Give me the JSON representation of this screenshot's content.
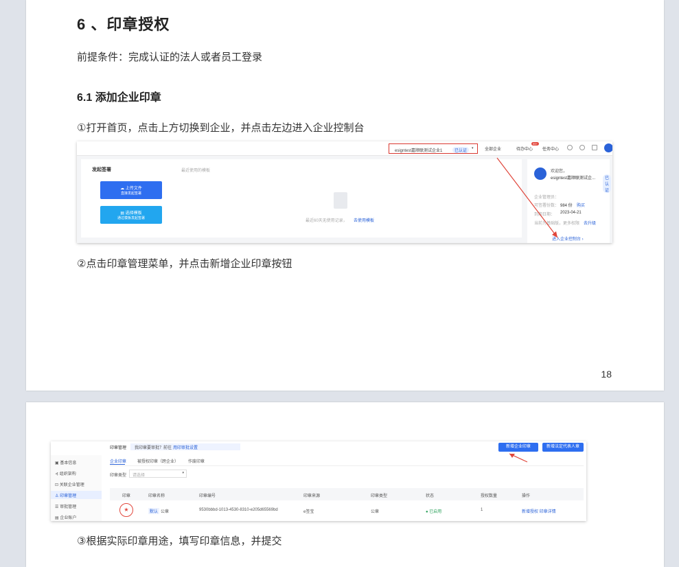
{
  "page1": {
    "heading": "6 、印章授权",
    "prerequisite": "前提条件：完成认证的法人或者员工登录",
    "subheading": "6.1 添加企业印章",
    "step1": "①打开首页，点击上方切换到企业，并点击左边进入企业控制台",
    "step2": "②点击印章管理菜单，并点击新增企业印章按钮",
    "page_number": "18",
    "screenshot": {
      "org_name": "esigntest嘉顺联测试企业1",
      "org_badge": "已认证",
      "menu": [
        "全部企业",
        "待办中心",
        "任务中心"
      ],
      "todo_count": "99+",
      "section_title": "发起签署",
      "recent_label": "最近使用的模板",
      "upload_btn": "上传文件",
      "upload_sub": "直接发起签署",
      "template_btn": "选择模板",
      "template_sub": "通过模板发起签署",
      "empty_text": "最近60天无使用记录，",
      "empty_link": "去使用模板",
      "welcome": "欢迎您，",
      "company": "esigntest嘉顺联测试企...",
      "company_badge": "已认证",
      "admin_label": "企业管理员：",
      "quota_label": "可签署份数：",
      "quota_value": "984 份",
      "buy_link": "购买",
      "expiry_label": "到期日期：",
      "expiry_value": "2023-04-21",
      "upgrade_text": "当前为基础版，更多权限",
      "upgrade_link": "去升级",
      "console_link": "进入企业控制台 ›"
    }
  },
  "page2": {
    "step3": "③根据实际印章用途，填写印章信息，并提交",
    "screenshot": {
      "title": "印章管理",
      "notice": "我印章要审批？前往",
      "notice_link": "用印审批设置",
      "btn_add": "新增企业印章",
      "btn_legal": "新增法定代表人章",
      "tabs": [
        "企业印章",
        "被授权印章（跨企业）",
        "作废印章"
      ],
      "filter_label": "印章类型",
      "filter_placeholder": "请选择",
      "sidebar": [
        "基本信息",
        "组织架构",
        "关联企业管理",
        "印章管理",
        "审批管理",
        "企业账户"
      ],
      "columns": [
        "印章",
        "印章名称",
        "印章编号",
        "印章来源",
        "印章类型",
        "状态",
        "授权数量",
        "操作"
      ],
      "row": {
        "tag": "默认",
        "name": "公章",
        "number": "9530bbbd-1013-4530-8310-e205d65569bd",
        "source": "e签宝",
        "type": "公章",
        "status": "● 已启用",
        "count": "1",
        "actions": "新增授权  印章详情"
      }
    }
  }
}
